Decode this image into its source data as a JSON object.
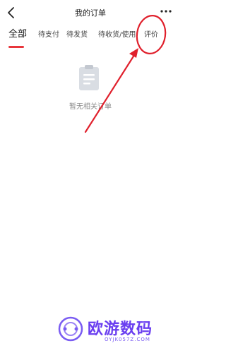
{
  "header": {
    "title": "我的订单",
    "back_icon": "chevron-left-icon",
    "more_icon": "more-dots-icon"
  },
  "tabs": [
    {
      "label": "全部",
      "active": true
    },
    {
      "label": "待支付",
      "active": false
    },
    {
      "label": "待发货",
      "active": false
    },
    {
      "label": "待收货/使用",
      "active": false
    },
    {
      "label": "评价",
      "active": false
    }
  ],
  "empty_state": {
    "icon": "clipboard-icon",
    "text": "暂无相关订单"
  },
  "annotation": {
    "color": "#e0202c",
    "shapes": [
      "circle",
      "arrow"
    ]
  },
  "watermark": {
    "name": "欧游数码",
    "domain": "OYJK057Z.COM",
    "color": "#6a3ef0"
  },
  "colors": {
    "accent": "#e8363c",
    "muted_text": "#8a8a8a"
  }
}
